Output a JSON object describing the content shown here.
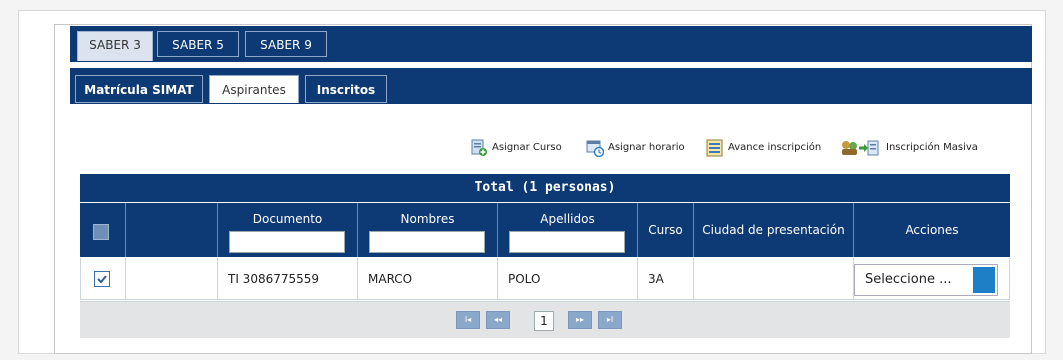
{
  "saber_tabs": [
    {
      "label": "SABER 3",
      "active": true
    },
    {
      "label": "SABER 5",
      "active": false
    },
    {
      "label": "SABER 9",
      "active": false
    }
  ],
  "sub_tabs": [
    {
      "label": "Matrícula SIMAT",
      "active": false
    },
    {
      "label": "Aspirantes",
      "active": true
    },
    {
      "label": "Inscritos",
      "active": false
    }
  ],
  "toolbar": {
    "asignar_curso": {
      "label": "Asignar Curso",
      "icon": "document-add-icon"
    },
    "asignar_horario": {
      "label": "Asignar horario",
      "icon": "schedule-icon"
    },
    "avance_inscripcion": {
      "label": "Avance inscripción",
      "icon": "report-icon"
    },
    "inscripcion_masiva": {
      "label": "Inscripción Masiva",
      "icon": "group-add-icon"
    }
  },
  "table": {
    "total_label": "Total (1 personas)",
    "columns": {
      "documento": "Documento",
      "nombres": "Nombres",
      "apellidos": "Apellidos",
      "curso": "Curso",
      "ciudad": "Ciudad de presentación",
      "acciones": "Acciones"
    },
    "rows": [
      {
        "checked": true,
        "documento": "TI 3086775559",
        "nombres": "MARCO",
        "apellidos": "POLO",
        "curso": "3A",
        "ciudad": "",
        "accion": "Seleccione ..."
      }
    ]
  },
  "pager": {
    "current_page": "1",
    "first": "I◂",
    "prev": "◂◂",
    "next": "▸▸",
    "last": "▸I"
  },
  "colors": {
    "header_blue": "#0d3a74",
    "accent_blue": "#1f7fc6",
    "pager_btn": "#8aa8c9"
  }
}
